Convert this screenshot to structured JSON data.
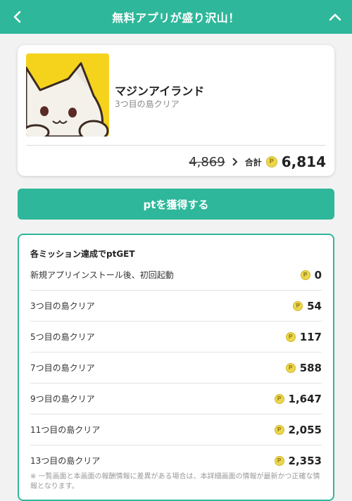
{
  "header": {
    "title": "無料アプリが盛り沢山！",
    "back_icon": "chevron-left-icon",
    "collapse_icon": "chevron-up-icon",
    "background": "#2eb79a"
  },
  "app": {
    "name": "マジンアイランド",
    "subtitle": "3つ目の島クリア",
    "icon_color": "#f5d21c",
    "old_points": "4,869",
    "total_label": "合計",
    "total_points": "6,814",
    "coin_glyph": "P"
  },
  "cta": {
    "label": "ptを獲得する"
  },
  "missions": {
    "title": "各ミッション達成でptGET",
    "items": [
      {
        "label": "新規アプリインストール後、初回起動",
        "points": "0"
      },
      {
        "label": "3つ目の島クリア",
        "points": "54"
      },
      {
        "label": "5つ目の島クリア",
        "points": "117"
      },
      {
        "label": "7つ目の島クリア",
        "points": "588"
      },
      {
        "label": "9つ目の島クリア",
        "points": "1,647"
      },
      {
        "label": "11つ目の島クリア",
        "points": "2,055"
      },
      {
        "label": "13つ目の島クリア",
        "points": "2,353"
      }
    ],
    "note": "※ 一覧画面と本画面の報酬情報に差異がある場合は、本詳細画面の情報が最新かつ正確な情報となります。"
  }
}
